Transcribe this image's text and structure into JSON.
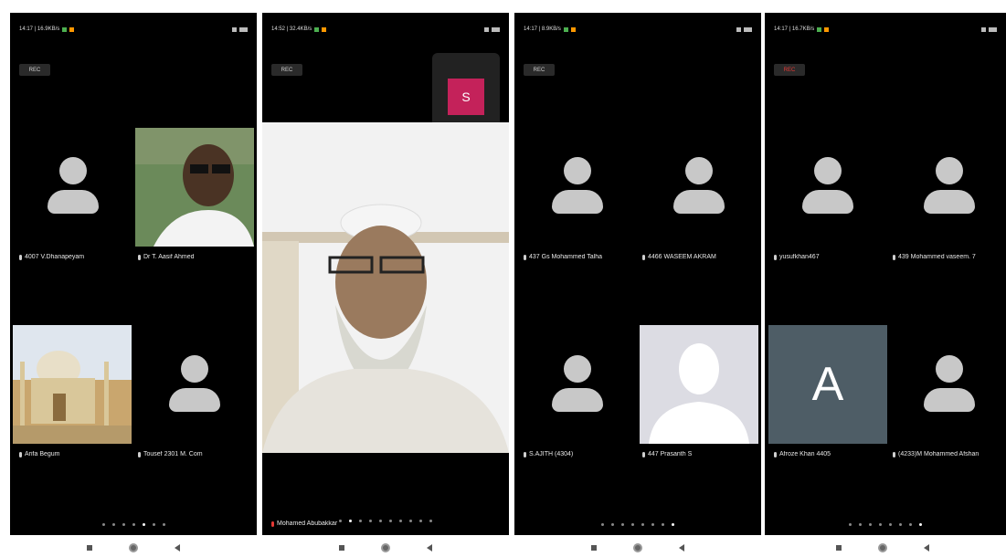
{
  "screens": [
    {
      "status_time": "14:17 | 16.9KB/s",
      "rec_label": "REC",
      "participants": [
        "4007 V.Dhanapeyam",
        "Dr T. Aasif Ahmed",
        "Arifa Begum",
        "Tousef 2301 M. Com"
      ],
      "page_dots": 7,
      "active_dot": 4
    },
    {
      "status_time": "14:52 | 32.4KB/s",
      "rec_label": "REC",
      "self_view_initial": "S",
      "speaker_name": "Mohamed Abubakkar",
      "page_dots": 10,
      "active_dot": 1
    },
    {
      "status_time": "14:17 | 8.9KB/s",
      "rec_label": "REC",
      "participants": [
        "437 Gs Mohammed Talha",
        "4466 WASEEM AKRAM",
        "S.AJITH (4304)",
        "447 Prasanth S"
      ],
      "page_dots": 8,
      "active_dot": 7
    },
    {
      "status_time": "14:17 | 16.7KB/s",
      "rec_label": "REC",
      "participants": [
        "yusufkhan467",
        "439 Mohammed vaseem. 7",
        "Afroze Khan 4405",
        "(4233)M Mohammed Afshan"
      ],
      "avatar_initial": "A",
      "page_dots": 8,
      "active_dot": 7
    }
  ],
  "colors": {
    "background": "#000000",
    "self_view_tile": "#c4225a",
    "letter_avatar_tile": "#4e5d66",
    "rec_dot_active": "#e53935"
  }
}
